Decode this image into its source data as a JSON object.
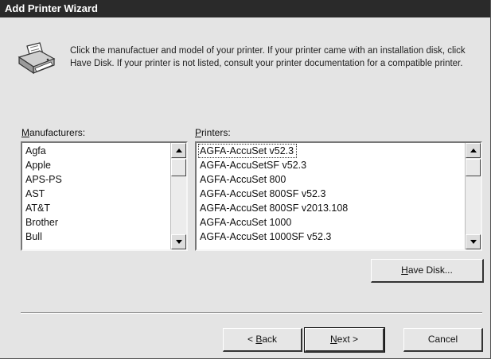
{
  "window": {
    "title": "Add Printer Wizard"
  },
  "intro": {
    "text": "Click the manufactuer and model of your printer.  If your printer came with an installation disk, click Have Disk.  If your printer is not listed, consult your printer documentation for a compatible printer."
  },
  "manufacturers": {
    "label_mnemonic": "M",
    "label_rest": "anufacturers:",
    "items": [
      "Agfa",
      "Apple",
      "APS-PS",
      "AST",
      "AT&T",
      "Brother",
      "Bull"
    ]
  },
  "printers": {
    "label_mnemonic": "P",
    "label_rest": "rinters:",
    "selected_index": 0,
    "items": [
      "AGFA-AccuSet v52.3",
      "AGFA-AccuSetSF v52.3",
      "AGFA-AccuSet 800",
      "AGFA-AccuSet 800SF v52.3",
      "AGFA-AccuSet 800SF v2013.108",
      "AGFA-AccuSet 1000",
      "AGFA-AccuSet 1000SF v52.3"
    ]
  },
  "buttons": {
    "have_disk": {
      "mnemonic": "H",
      "rest": "ave Disk..."
    },
    "back": {
      "prefix": "< ",
      "mnemonic": "B",
      "rest": "ack"
    },
    "next": {
      "mnemonic": "N",
      "rest": "ext >"
    },
    "cancel": "Cancel"
  },
  "colors": {
    "titlebar_bg": "#2a2a2a",
    "dialog_bg": "#e4e4e4"
  }
}
